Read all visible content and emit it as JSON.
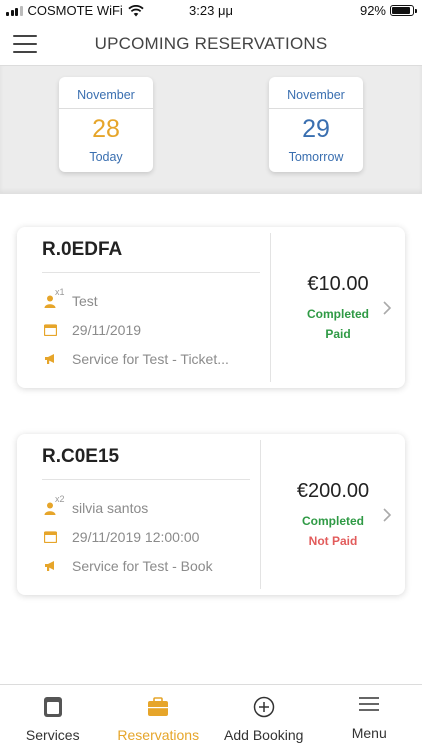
{
  "status_bar": {
    "carrier": "COSMOTE WiFi",
    "time": "3:23 μμ",
    "battery_text": "92%",
    "battery_level": 0.92
  },
  "header": {
    "title": "UPCOMING RESERVATIONS",
    "menu_icon": "hamburger-icon"
  },
  "date_selector": [
    {
      "month": "November",
      "day": "28",
      "label": "Today",
      "day_color": "#e6a52a"
    },
    {
      "month": "November",
      "day": "29",
      "label": "Tomorrow",
      "day_color": "#3a6fb0"
    }
  ],
  "reservations": [
    {
      "code": "R.0EDFA",
      "guests": "x1",
      "customer": "Test",
      "date": "29/11/2019",
      "service": "Service for Test - Ticket...",
      "price": "€10.00",
      "status": "Completed",
      "payment": "Paid",
      "payment_color": "#2f9a45"
    },
    {
      "code": "R.C0E15",
      "guests": "x2",
      "customer": "silvia santos",
      "date": "29/11/2019 12:00:00",
      "service": "Service for Test - Book",
      "price": "€200.00",
      "status": "Completed",
      "payment": "Not Paid",
      "payment_color": "#e25b5b"
    }
  ],
  "bottom_nav": [
    {
      "label": "Services",
      "icon": "services-icon",
      "active": false
    },
    {
      "label": "Reservations",
      "icon": "briefcase-icon",
      "active": true
    },
    {
      "label": "Add Booking",
      "icon": "add-circle-icon",
      "active": false
    },
    {
      "label": "Menu",
      "icon": "menu-lines-icon",
      "active": false
    }
  ],
  "colors": {
    "accent": "#e6a52a",
    "link_blue": "#3a6fb0",
    "icon_orange": "#e6a52a",
    "paid_green": "#2f9a45",
    "not_paid_red": "#e25b5b"
  }
}
